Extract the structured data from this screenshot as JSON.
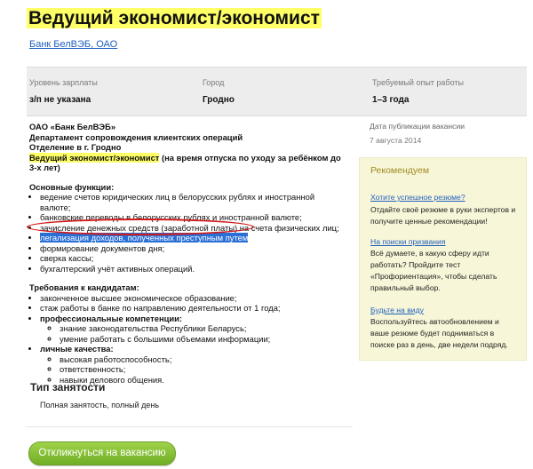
{
  "vacancy": {
    "title": "Ведущий экономист/экономист",
    "employer": "Банк БелВЭБ, ОАО"
  },
  "stats": {
    "salary": {
      "label": "Уровень зарплаты",
      "value": "з/п не указана"
    },
    "city": {
      "label": "Город",
      "value": "Гродно"
    },
    "experience": {
      "label": "Требуемый опыт работы",
      "value": "1–3 года"
    }
  },
  "description": {
    "company": "ОАО «Банк БелВЭБ»",
    "department": "Департамент сопровождения клиентских операций",
    "branch": "Отделение в г. Гродно",
    "position_highlight": "Ведущий экономист/экономист",
    "position_rest": " (на время отпуска по уходу за ребёнком до 3-х лет)",
    "functions_title": "Основные функции:",
    "functions": [
      "ведение счетов юридических лиц в белорусских рублях и иностранной валюте;",
      "банковские переводы в белорусских рублях и иностранной валюте;",
      "зачисление денежных средств (заработной платы) на счета физических лиц;",
      "легализация доходов, полученных преступным путем",
      "формирование документов дня;",
      "сверка кассы;",
      "бухгалтерский учёт активных операций."
    ],
    "requirements_title": "Требования к кандидатам:",
    "requirements": [
      "законченное высшее экономическое образование;",
      "стаж работы в банке по  направлению деятельности от 1 года;"
    ],
    "competencies_title": "профессиональные компетенции:",
    "competencies": [
      "знание законодательства Республики Беларусь;",
      "умение работать с большими объемами информации;"
    ],
    "personal_title": "личные качества:",
    "personal": [
      "высокая работоспособность;",
      "ответственность;",
      "навыки делового общения."
    ]
  },
  "employment": {
    "title": "Тип занятости",
    "value": "Полная занятость, полный день"
  },
  "apply_button": "Откликнуться на вакансию",
  "publication": {
    "label": "Дата публикации вакансии",
    "date": "7 августа 2014"
  },
  "recommend": {
    "title": "Рекомендуем",
    "items": [
      {
        "link": "Хотите успешное резюме?",
        "text": "Отдайте своё резюме в руки экспертов и получите ценные рекомендации!"
      },
      {
        "link": "На поиски призвания",
        "text": "Всё думаете, в какую сферу идти работать? Пройдите тест «Профориентация», чтобы сделать правильный выбор."
      },
      {
        "link": "Будьте на виду",
        "text": "Воспользуйтесь автообновлением и ваше резюме будет подниматься в поиске раз в день, две недели подряд."
      }
    ]
  },
  "colors": {
    "highlight": "#ffff66",
    "link": "#1f5fbf",
    "button_green": "#7fbf30",
    "annotation_circle": "#d11a1a",
    "selection": "#2a6fd6"
  }
}
